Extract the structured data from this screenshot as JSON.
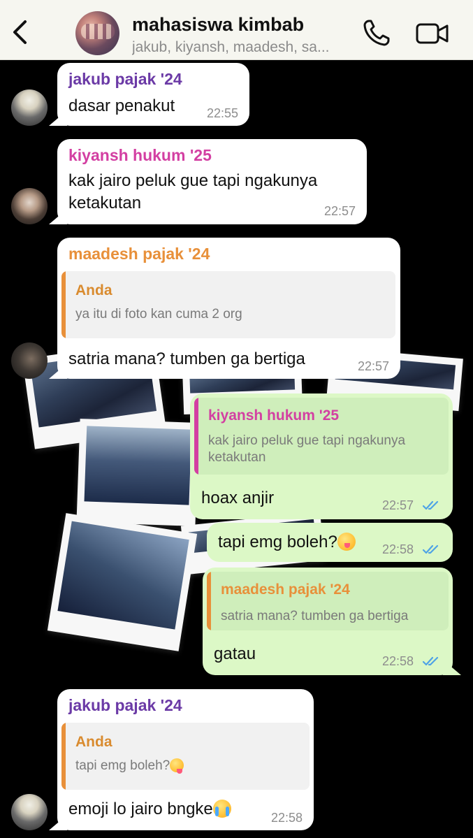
{
  "header": {
    "title": "mahasiswa kimbab",
    "subtitle": "jakub, kiyansh, maadesh, sa..."
  },
  "icons": {
    "back": "chevron-left-icon",
    "call": "phone-icon",
    "video": "video-camera-icon",
    "read": "double-check-icon"
  },
  "colors": {
    "purple_sender": "#6b3aa6",
    "pink_sender": "#d33fa2",
    "orange_sender": "#e8903a",
    "incoming_bubble": "#ffffff",
    "outgoing_bubble": "#dcf8c6",
    "read_ticks": "#4fa3e6"
  },
  "messages": [
    {
      "sender": "jakub pajak '24",
      "text": "dasar penakut",
      "time": "22:55"
    },
    {
      "sender": "kiyansh hukum '25",
      "text_line1": "kak jairo peluk gue tapi ngakunya",
      "text_line2": "ketakutan",
      "time": "22:57"
    },
    {
      "sender": "maadesh pajak '24",
      "quote_name": "Anda",
      "quote_text": "ya itu di foto kan cuma 2 org",
      "text": "satria mana? tumben ga bertiga",
      "time": "22:57"
    },
    {
      "quote_name": "kiyansh hukum '25",
      "quote_line1": "kak jairo peluk gue tapi ngakunya",
      "quote_line2": "ketakutan",
      "text": "hoax anjir",
      "time": "22:57"
    },
    {
      "text": "tapi emg boleh?",
      "time": "22:58"
    },
    {
      "quote_name": "maadesh pajak '24",
      "quote_text": "satria mana? tumben ga bertiga",
      "text": "gatau",
      "time": "22:58"
    },
    {
      "sender": "jakub pajak '24",
      "quote_name": "Anda",
      "quote_text": "tapi emg boleh?",
      "text": "emoji lo jairo bngke",
      "time": "22:58"
    }
  ]
}
